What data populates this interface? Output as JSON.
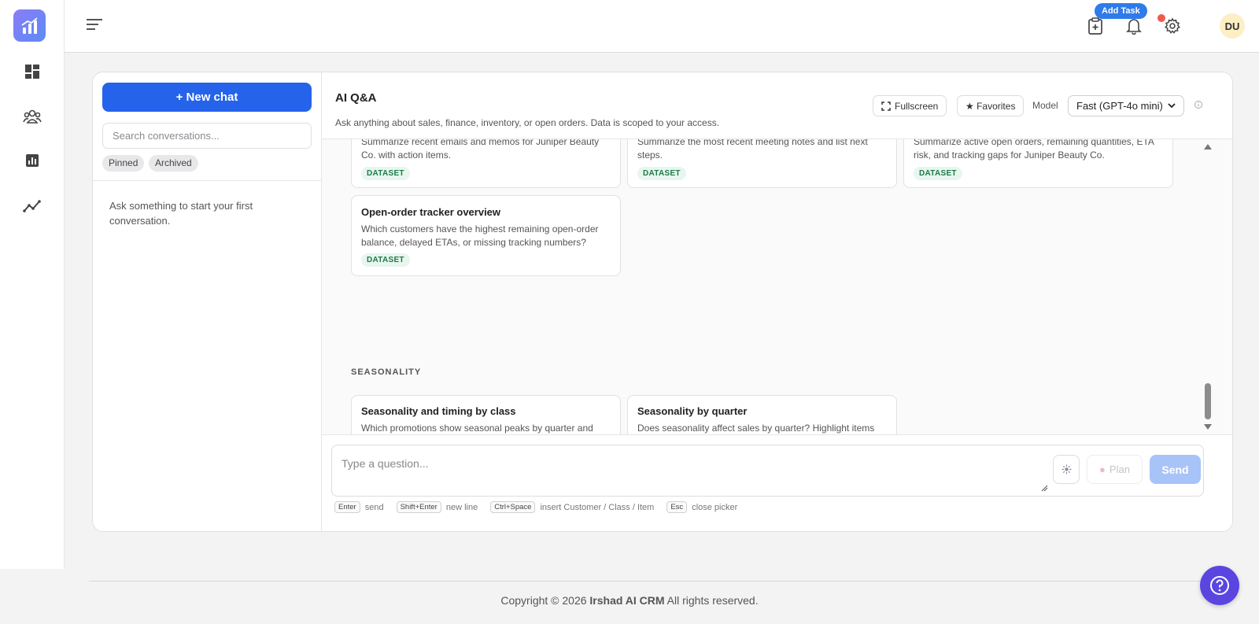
{
  "topbar": {
    "add_task_label": "Add Task",
    "avatar_initials": "DU"
  },
  "sidebar": {
    "new_chat_label": "+ New chat",
    "search_placeholder": "Search conversations...",
    "filters": [
      "Pinned",
      "Archived"
    ],
    "empty_text": "Ask something to start your first conversation."
  },
  "chat": {
    "title": "AI Q&A",
    "subtitle": "Ask anything about sales, finance, inventory, or open orders. Data is scoped to your access.",
    "fullscreen_label": "Fullscreen",
    "favorites_label": "★ Favorites",
    "model_label": "Model",
    "model_value": "Fast (GPT-4o mini)"
  },
  "prompts_top": [
    {
      "desc": "Summarize recent emails and memos for Juniper Beauty Co. with action items.",
      "tag": "DATASET"
    },
    {
      "desc": "Summarize the most recent meeting notes and list next steps.",
      "tag": "DATASET"
    },
    {
      "desc": "Summarize active open orders, remaining quantities, ETA risk, and tracking gaps for Juniper Beauty Co.",
      "tag": "DATASET"
    }
  ],
  "prompt_open_order": {
    "title": "Open-order tracker overview",
    "desc": "Which customers have the highest remaining open-order balance, delayed ETAs, or missing tracking numbers?",
    "tag": "DATASET"
  },
  "seasonality": {
    "section_label": "SEASONALITY",
    "cards": [
      {
        "title": "Seasonality and timing by class",
        "desc": "Which promotions show seasonal peaks by quarter and what is the best timing by class?"
      },
      {
        "title": "Seasonality by quarter",
        "desc": "Does seasonality affect sales by quarter? Highlight items with peaks."
      }
    ]
  },
  "composer": {
    "placeholder": "Type a question...",
    "plan_label": "Plan",
    "send_label": "Send",
    "hints": [
      {
        "key": "Enter",
        "text": "send"
      },
      {
        "key": "Shift+Enter",
        "text": "new line"
      },
      {
        "key": "Ctrl+Space",
        "text": "insert Customer / Class / Item"
      },
      {
        "key": "Esc",
        "text": "close picker"
      }
    ]
  },
  "footer": {
    "prefix": "Copyright © 2026 ",
    "brand": "Irshad AI CRM",
    "suffix": " All rights reserved."
  },
  "colors": {
    "primary": "#2563eb",
    "help": "#5b45e0",
    "tag_bg": "#e7f6ee",
    "tag_text": "#1e7a4a"
  }
}
